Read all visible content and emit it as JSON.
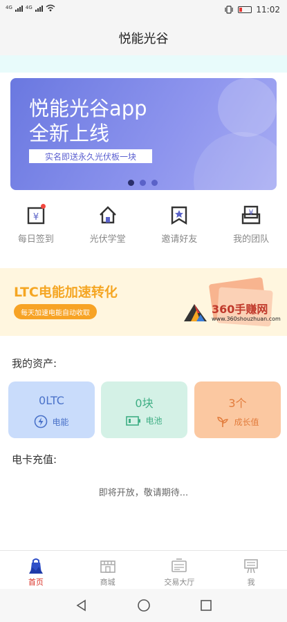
{
  "status_bar": {
    "time": "11:02",
    "network_1": "4G",
    "network_2": "4G"
  },
  "header": {
    "title": "悦能光谷"
  },
  "banner": {
    "title_line1": "悦能光谷app",
    "title_line2": "全新上线",
    "tagline": "实名即送永久光伏板一块"
  },
  "quick_actions": [
    {
      "label": "每日签到",
      "icon": "calendar-yen-icon"
    },
    {
      "label": "光伏学堂",
      "icon": "house-icon"
    },
    {
      "label": "邀请好友",
      "icon": "bookmark-star-icon"
    },
    {
      "label": "我的团队",
      "icon": "team-card-icon"
    }
  ],
  "promo": {
    "title": "LTC电能加速转化",
    "subtitle": "每天加速电能自动收取",
    "watermark_main": "360手赚网",
    "watermark_sub": "www.360shouzhuan.com"
  },
  "assets": {
    "section_title": "我的资产:",
    "items": [
      {
        "value": "0LTC",
        "label": "电能",
        "icon": "lightning-icon",
        "bg": "#c9dcfb",
        "color": "#4a72c9"
      },
      {
        "value": "0块",
        "label": "电池",
        "icon": "battery-icon",
        "bg": "#d4f1e6",
        "color": "#3fae84"
      },
      {
        "value": "3个",
        "label": "成长值",
        "icon": "sprout-icon",
        "bg": "#fbc8a1",
        "color": "#e27c3c"
      }
    ]
  },
  "recharge": {
    "section_title": "电卡充值:",
    "message": "即将开放，敬请期待..."
  },
  "tabbar": [
    {
      "label": "首页",
      "icon": "home-bag-icon",
      "active": true
    },
    {
      "label": "商城",
      "icon": "store-icon",
      "active": false
    },
    {
      "label": "交易大厅",
      "icon": "trade-hall-icon",
      "active": false
    },
    {
      "label": "我",
      "icon": "profile-icon",
      "active": false
    }
  ],
  "colors": {
    "accent": "#d93025",
    "banner": "#7b83e6",
    "promo_title": "#f5a623"
  }
}
